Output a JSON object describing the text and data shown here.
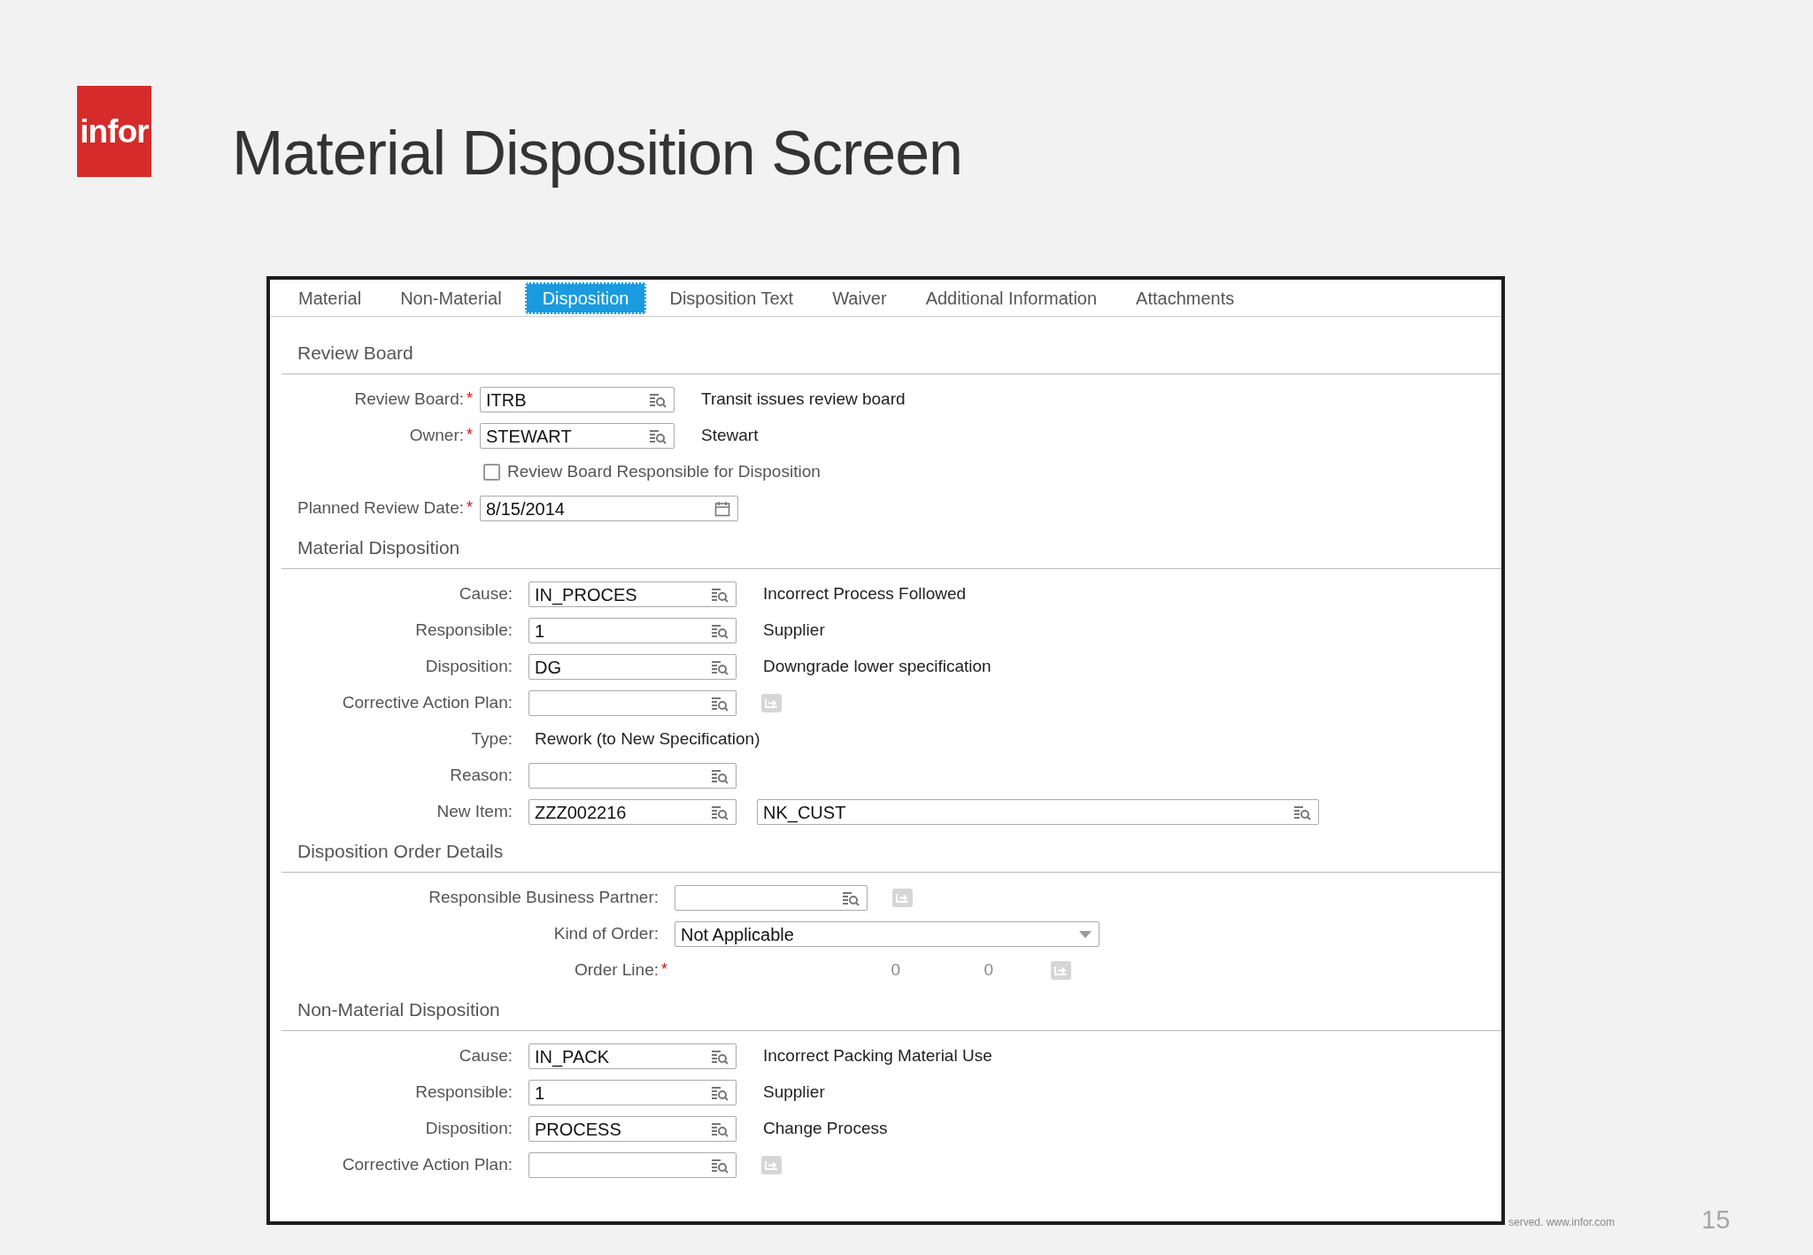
{
  "slide": {
    "logo": "infor",
    "title": "Material Disposition Screen",
    "footer": "served. www.infor.com",
    "page_number": "15"
  },
  "tabs": [
    {
      "label": "Material",
      "selected": false
    },
    {
      "label": "Non-Material",
      "selected": false
    },
    {
      "label": "Disposition",
      "selected": true
    },
    {
      "label": "Disposition Text",
      "selected": false
    },
    {
      "label": "Waiver",
      "selected": false
    },
    {
      "label": "Additional Information",
      "selected": false
    },
    {
      "label": "Attachments",
      "selected": false
    }
  ],
  "sections": [
    {
      "title": "Review Board",
      "rows": [
        {
          "kind": "lookup",
          "label": "Review Board:",
          "required_mark": "*",
          "value": "ITRB",
          "description": "Transit issues review board"
        },
        {
          "kind": "lookup",
          "label": "Owner:",
          "required_mark": "*",
          "value": "STEWART",
          "description": "Stewart"
        },
        {
          "kind": "checkbox",
          "label": "Review Board Responsible for Disposition",
          "checked": false
        },
        {
          "kind": "date",
          "label": "Planned Review Date:",
          "required_mark": "*",
          "value": "8/15/2014"
        }
      ]
    },
    {
      "title": "Material Disposition",
      "rows": [
        {
          "kind": "lookup",
          "label": "Cause:",
          "value": "IN_PROCES",
          "description": "Incorrect Process Followed"
        },
        {
          "kind": "lookup",
          "label": "Responsible:",
          "value": "1",
          "description": "Supplier"
        },
        {
          "kind": "lookup",
          "label": "Disposition:",
          "value": "DG",
          "description": "Downgrade lower specification"
        },
        {
          "kind": "lookup",
          "label": "Corrective Action Plan:",
          "link_button": true
        },
        {
          "kind": "text",
          "label": "Type:",
          "value": "Rework (to New Specification)"
        },
        {
          "kind": "lookup",
          "label": "Reason:"
        },
        {
          "kind": "lookup",
          "label": "New Item:",
          "value": "ZZZ002216",
          "extra_value": "NK_CUST"
        }
      ]
    },
    {
      "title": "Disposition Order Details",
      "rows": [
        {
          "kind": "lookup",
          "label": "Responsible Business Partner:",
          "link_button": true
        },
        {
          "kind": "dropdown",
          "label": "Kind of Order:",
          "value": "Not Applicable"
        },
        {
          "kind": "order_line",
          "label": "Order Line:",
          "required_mark": "*",
          "values": [
            "0",
            "0"
          ],
          "link_button": true
        }
      ]
    },
    {
      "title": "Non-Material Disposition",
      "rows": [
        {
          "kind": "lookup",
          "label": "Cause:",
          "value": "IN_PACK",
          "description": "Incorrect Packing Material Use"
        },
        {
          "kind": "lookup",
          "label": "Responsible:",
          "value": "1",
          "description": "Supplier"
        },
        {
          "kind": "lookup",
          "label": "Disposition:",
          "value": "PROCESS",
          "description": "Change Process"
        },
        {
          "kind": "lookup",
          "label": "Corrective Action Plan:",
          "link_button": true
        }
      ]
    }
  ]
}
